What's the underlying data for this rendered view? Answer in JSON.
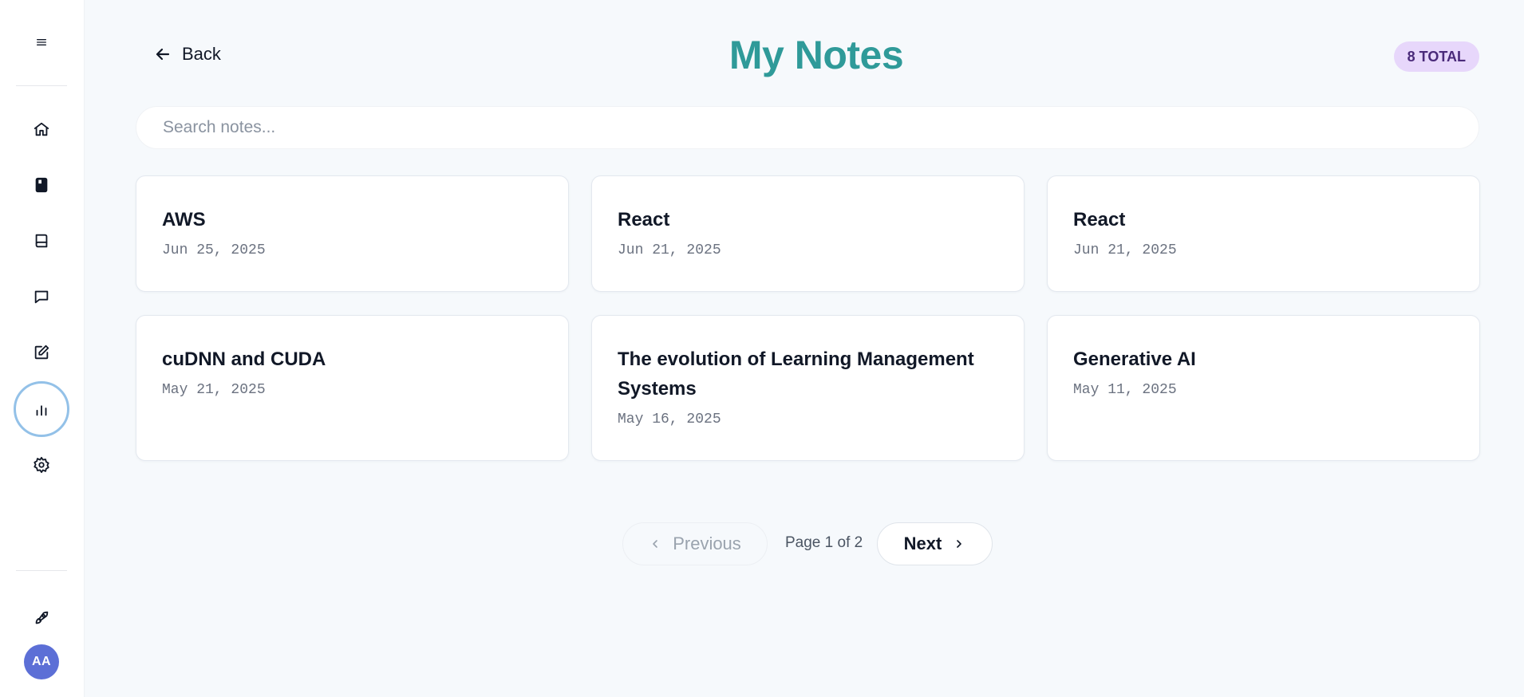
{
  "header": {
    "back_label": "Back",
    "title": "My Notes",
    "total_badge": "8 TOTAL"
  },
  "search": {
    "placeholder": "Search notes...",
    "value": ""
  },
  "sidebar": {
    "items": [
      {
        "name": "menu",
        "icon": "menu-icon"
      },
      {
        "name": "home",
        "icon": "home-icon"
      },
      {
        "name": "notebook",
        "icon": "notebook-icon"
      },
      {
        "name": "book",
        "icon": "book-icon"
      },
      {
        "name": "chat",
        "icon": "chat-icon"
      },
      {
        "name": "edit",
        "icon": "edit-icon"
      },
      {
        "name": "analytics",
        "icon": "bar-chart-icon",
        "active": true
      },
      {
        "name": "settings",
        "icon": "gear-icon"
      },
      {
        "name": "launch",
        "icon": "rocket-icon"
      }
    ],
    "avatar_initials": "AA"
  },
  "notes": [
    {
      "title": "AWS",
      "date": "Jun 25, 2025"
    },
    {
      "title": "React",
      "date": "Jun 21, 2025"
    },
    {
      "title": "React",
      "date": "Jun 21, 2025"
    },
    {
      "title": "cuDNN and CUDA",
      "date": "May 21, 2025"
    },
    {
      "title": "The evolution of Learning Management Systems",
      "date": "May 16, 2025"
    },
    {
      "title": "Generative AI",
      "date": "May 11, 2025"
    }
  ],
  "pagination": {
    "previous_label": "Previous",
    "page_label": "Page 1 of 2",
    "next_label": "Next"
  },
  "colors": {
    "title": "#2f9a99",
    "badge_bg": "#e7d7fb",
    "badge_text": "#4a2a7a",
    "avatar_bg": "#5c6fd6",
    "active_ring": "#93c1e8"
  }
}
